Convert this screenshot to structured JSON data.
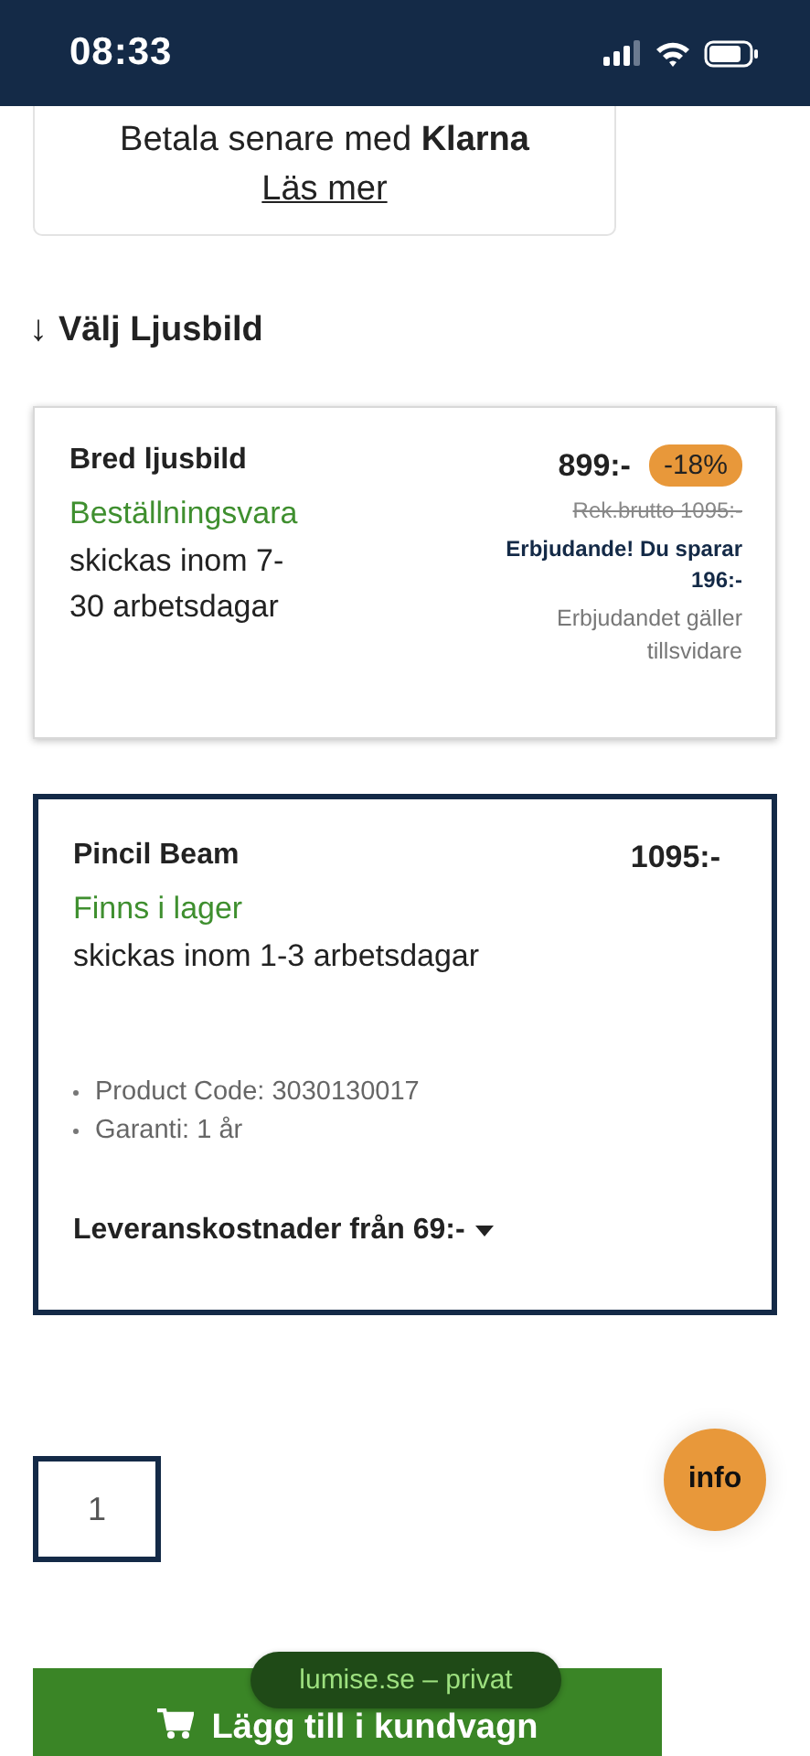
{
  "status_bar": {
    "time": "08:33"
  },
  "klarna": {
    "text": "Betala senare med **Klarna**",
    "link": "Läs mer"
  },
  "section_heading": {
    "arrow": "↓",
    "title": "Välj Ljusbild"
  },
  "options": [
    {
      "selected": false,
      "name": "Bred ljusbild",
      "price": "899:-",
      "discount": "-18%",
      "old_price": "Rek.brutto 1095:-",
      "offer": "Erbjudande! Du sparar 196:-",
      "offer_note": "Erbjudandet gäller tillsvidare",
      "availability": "Beställningsvara",
      "delivery": "skickas inom 7-30 arbetsdagar"
    },
    {
      "selected": true,
      "name": "Pincil Beam",
      "price": "1095:-",
      "availability": "Finns i lager",
      "delivery": "skickas inom 1-3 arbetsdagar",
      "details": [
        "Product Code: 3030130017",
        "Garanti: 1 år"
      ],
      "shipping": "Leveranskostnader från 69:-"
    }
  ],
  "quantity": {
    "value": "1"
  },
  "info_button": {
    "label": "info"
  },
  "add_to_cart": {
    "label": "Lägg till i kundvagn"
  },
  "browser_pill": {
    "text": "lumise.se – privat"
  }
}
